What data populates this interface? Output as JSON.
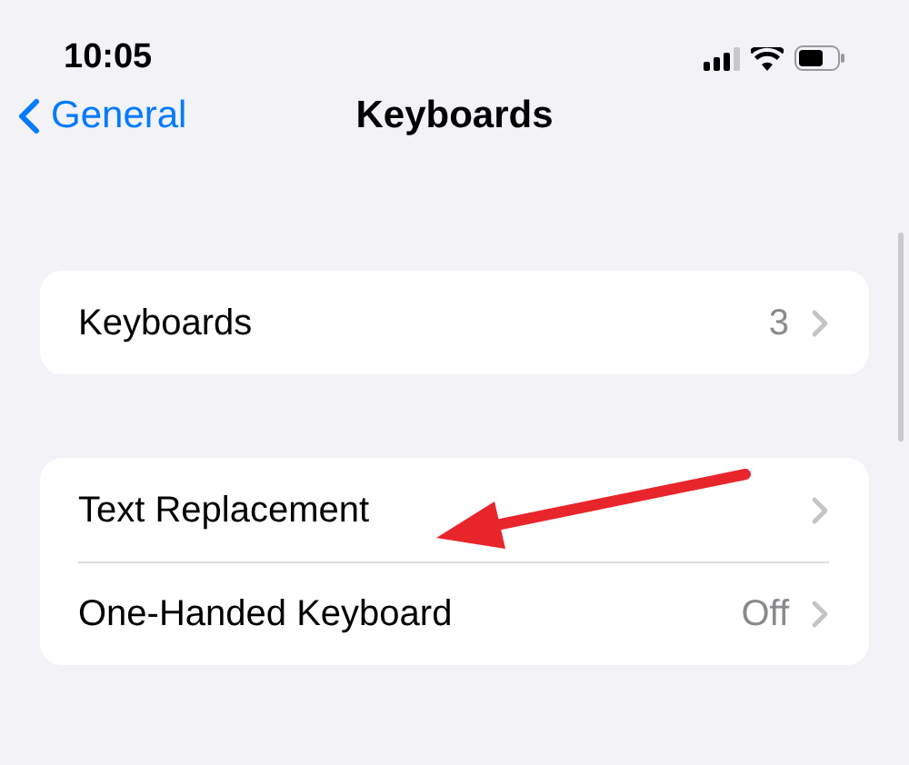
{
  "status_bar": {
    "time": "10:05"
  },
  "nav": {
    "back": "General",
    "title": "Keyboards"
  },
  "groups": [
    [
      {
        "label": "Keyboards",
        "value": "3"
      }
    ],
    [
      {
        "label": "Text Replacement"
      },
      {
        "label": "One-Handed Keyboard",
        "value": "Off"
      }
    ]
  ]
}
